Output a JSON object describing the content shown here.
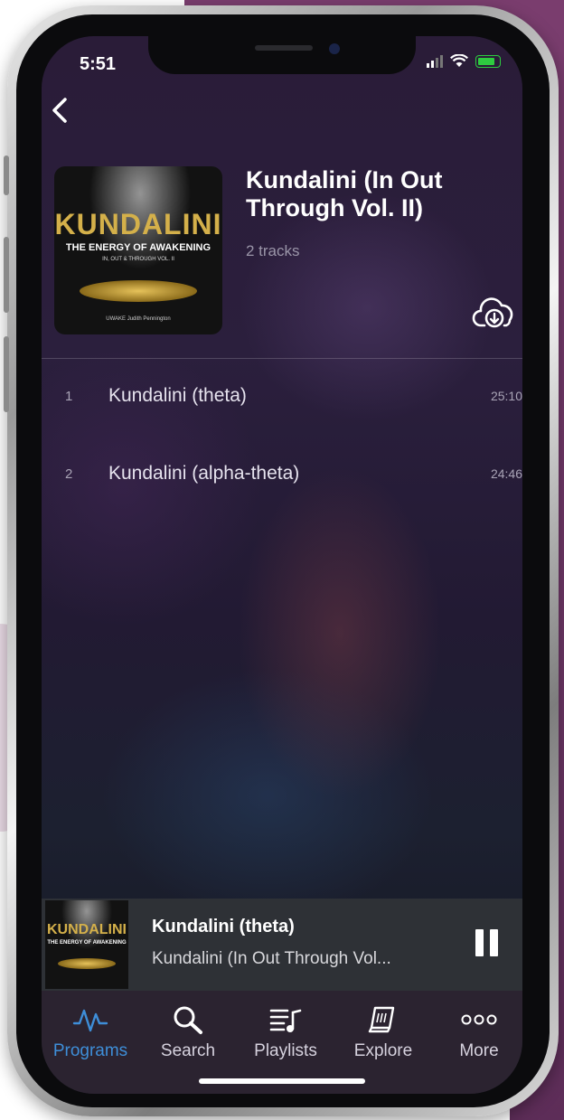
{
  "status": {
    "time": "5:51"
  },
  "album": {
    "title": "Kundalini (In Out Through Vol. II)",
    "track_count": "2 tracks",
    "cover": {
      "main": "KUNDALINI",
      "subtitle": "THE ENERGY OF AWAKENING",
      "small": "IN, OUT & THROUGH VOL. II",
      "credit": "UWAKE   Judith Pennington"
    }
  },
  "tracks": [
    {
      "num": "1",
      "name": "Kundalini (theta)",
      "duration": "25:10"
    },
    {
      "num": "2",
      "name": "Kundalini (alpha-theta)",
      "duration": "24:46"
    }
  ],
  "now_playing": {
    "title": "Kundalini (theta)",
    "subtitle": "Kundalini (In Out Through Vol...",
    "cover_main": "KUNDALINI",
    "cover_subtitle": "THE ENERGY OF AWAKENING"
  },
  "tabs": [
    {
      "label": "Programs",
      "icon": "waveform-icon",
      "active": true
    },
    {
      "label": "Search",
      "icon": "search-icon",
      "active": false
    },
    {
      "label": "Playlists",
      "icon": "playlist-icon",
      "active": false
    },
    {
      "label": "Explore",
      "icon": "book-icon",
      "active": false
    },
    {
      "label": "More",
      "icon": "more-icon",
      "active": false
    }
  ],
  "colors": {
    "accent": "#3e8ed8",
    "tab_bg": "#2b2330",
    "mini_player_bg": "#2e3136"
  }
}
